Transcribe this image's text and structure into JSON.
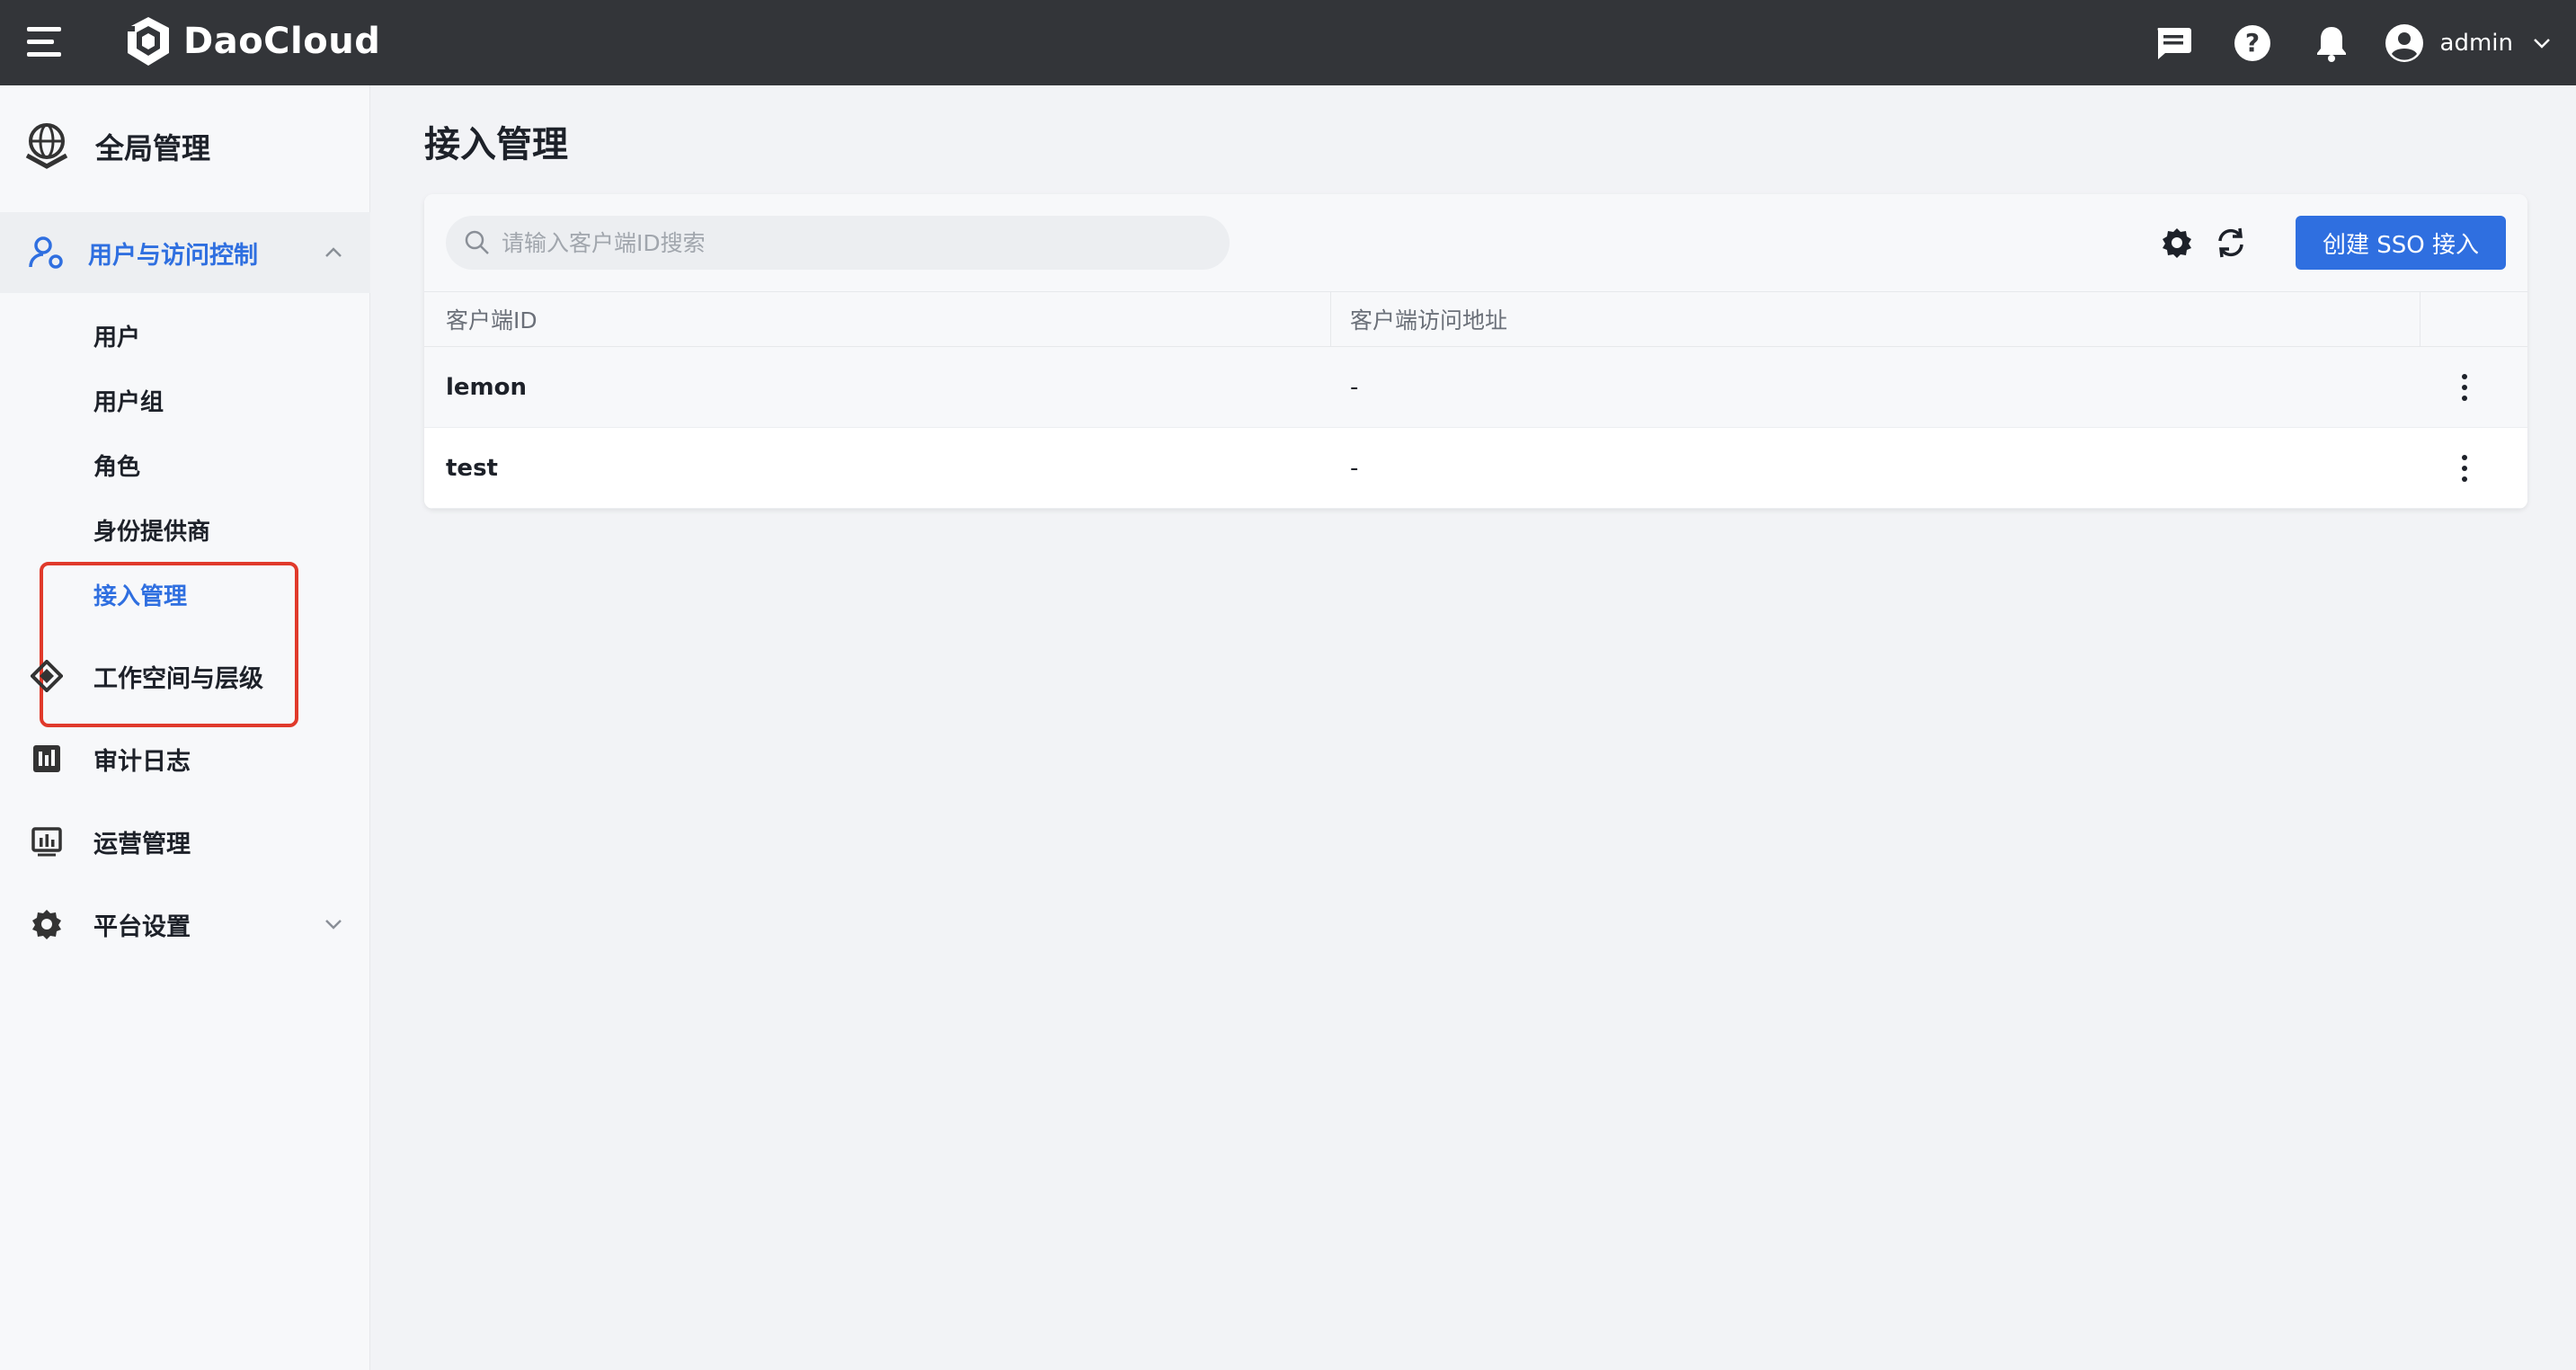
{
  "topbar": {
    "brand": "DaoCloud",
    "user": "admin",
    "icons": [
      "message-icon",
      "help-icon",
      "bell-icon",
      "user-avatar-icon",
      "chevron-down-icon"
    ]
  },
  "sidebar": {
    "header": "全局管理",
    "group": {
      "label": "用户与访问控制",
      "expanded": true,
      "items": [
        {
          "label": "用户"
        },
        {
          "label": "用户组"
        },
        {
          "label": "角色"
        },
        {
          "label": "身份提供商"
        },
        {
          "label": "接入管理",
          "active": true
        }
      ]
    },
    "items": [
      {
        "label": "工作空间与层级",
        "icon": "workspace-icon"
      },
      {
        "label": "审计日志",
        "icon": "audit-log-icon"
      },
      {
        "label": "运营管理",
        "icon": "operations-icon"
      },
      {
        "label": "平台设置",
        "icon": "settings-icon"
      }
    ]
  },
  "main": {
    "title": "接入管理",
    "search": {
      "placeholder": "请输入客户端ID搜索",
      "value": ""
    },
    "create_label": "创建 SSO 接入",
    "columns": [
      "客户端ID",
      "客户端访问地址"
    ],
    "rows": [
      {
        "id": "lemon",
        "address": "-"
      },
      {
        "id": "test",
        "address": "-"
      }
    ]
  },
  "colors": {
    "topbar": "#333539",
    "accent": "#2f6fe0",
    "highlight": "#e03a2b"
  }
}
